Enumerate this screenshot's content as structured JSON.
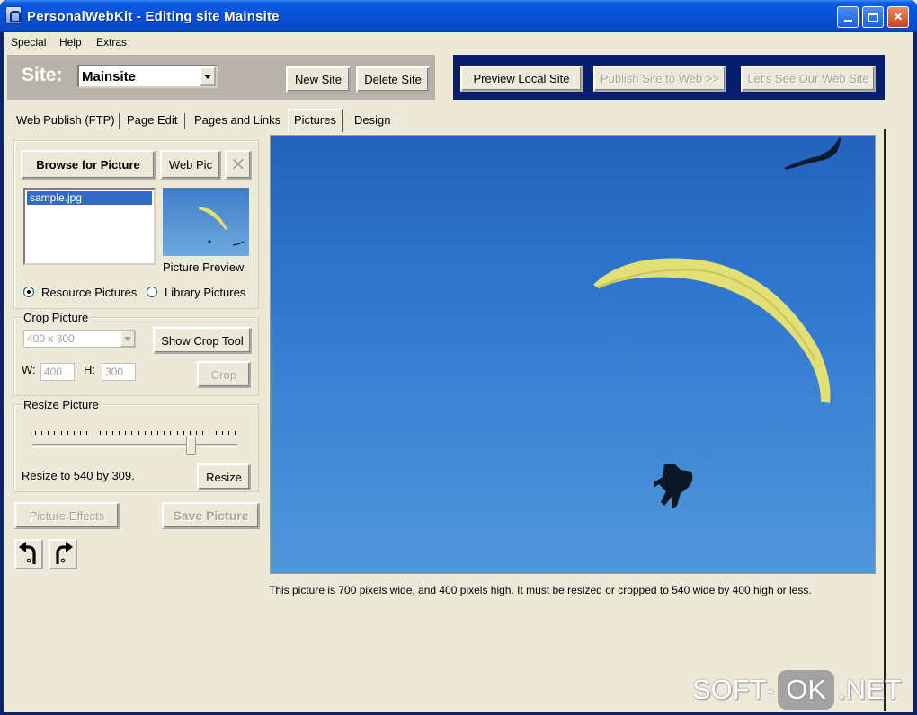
{
  "window": {
    "title": "PersonalWebKit - Editing site Mainsite",
    "minimize": "minimize",
    "maximize": "maximize",
    "close": "✕"
  },
  "menu": [
    "Special",
    "Help",
    "Extras"
  ],
  "site": {
    "label": "Site:",
    "selected": "Mainsite",
    "new_site": "New Site",
    "delete_site": "Delete Site"
  },
  "actions": {
    "preview_local": "Preview Local Site",
    "publish_web": "Publish Site to Web >>",
    "see_web_site": "Let's See Our Web Site"
  },
  "tabs": [
    {
      "label": "Web Publish (FTP)",
      "active": false
    },
    {
      "label": "Page Edit",
      "active": false
    },
    {
      "label": "Pages and Links",
      "active": false
    },
    {
      "label": "Pictures",
      "active": true
    },
    {
      "label": "Design",
      "active": false
    }
  ],
  "pictures": {
    "browse": "Browse for Picture",
    "web_pic": "Web Pic",
    "remove": "✕",
    "files": [
      "sample.jpg"
    ],
    "preview_caption": "Picture Preview",
    "source_options": [
      {
        "label": "Resource Pictures",
        "checked": true
      },
      {
        "label": "Library Pictures",
        "checked": false
      }
    ]
  },
  "crop": {
    "title": "Crop Picture",
    "size": "400 x 300",
    "show_tool": "Show Crop Tool",
    "w_label": "W:",
    "w_value": "400",
    "h_label": "H:",
    "h_value": "300",
    "crop_button": "Crop"
  },
  "resize": {
    "title": "Resize Picture",
    "slider_level": 0.77,
    "status": "Resize to 540 by 309.",
    "button": "Resize"
  },
  "bottom_buttons": {
    "effects": "Picture Effects",
    "save": "Save Picture"
  },
  "rotate": {
    "left": "rotate-left-icon",
    "right": "rotate-right-icon"
  },
  "info": "This picture is 700 pixels wide, and 400 pixels high. It must be resized or cropped to 540 wide by 400 high or less.",
  "watermark": {
    "left": "SOFT-",
    "mid": "OK",
    "right": ".NET"
  },
  "colors": {
    "titlebar": "#0751d8",
    "selection": "#316ac5",
    "preview_panel": "#0a1e6e",
    "sky": "#2f76cf",
    "glider": "#e2df74"
  }
}
